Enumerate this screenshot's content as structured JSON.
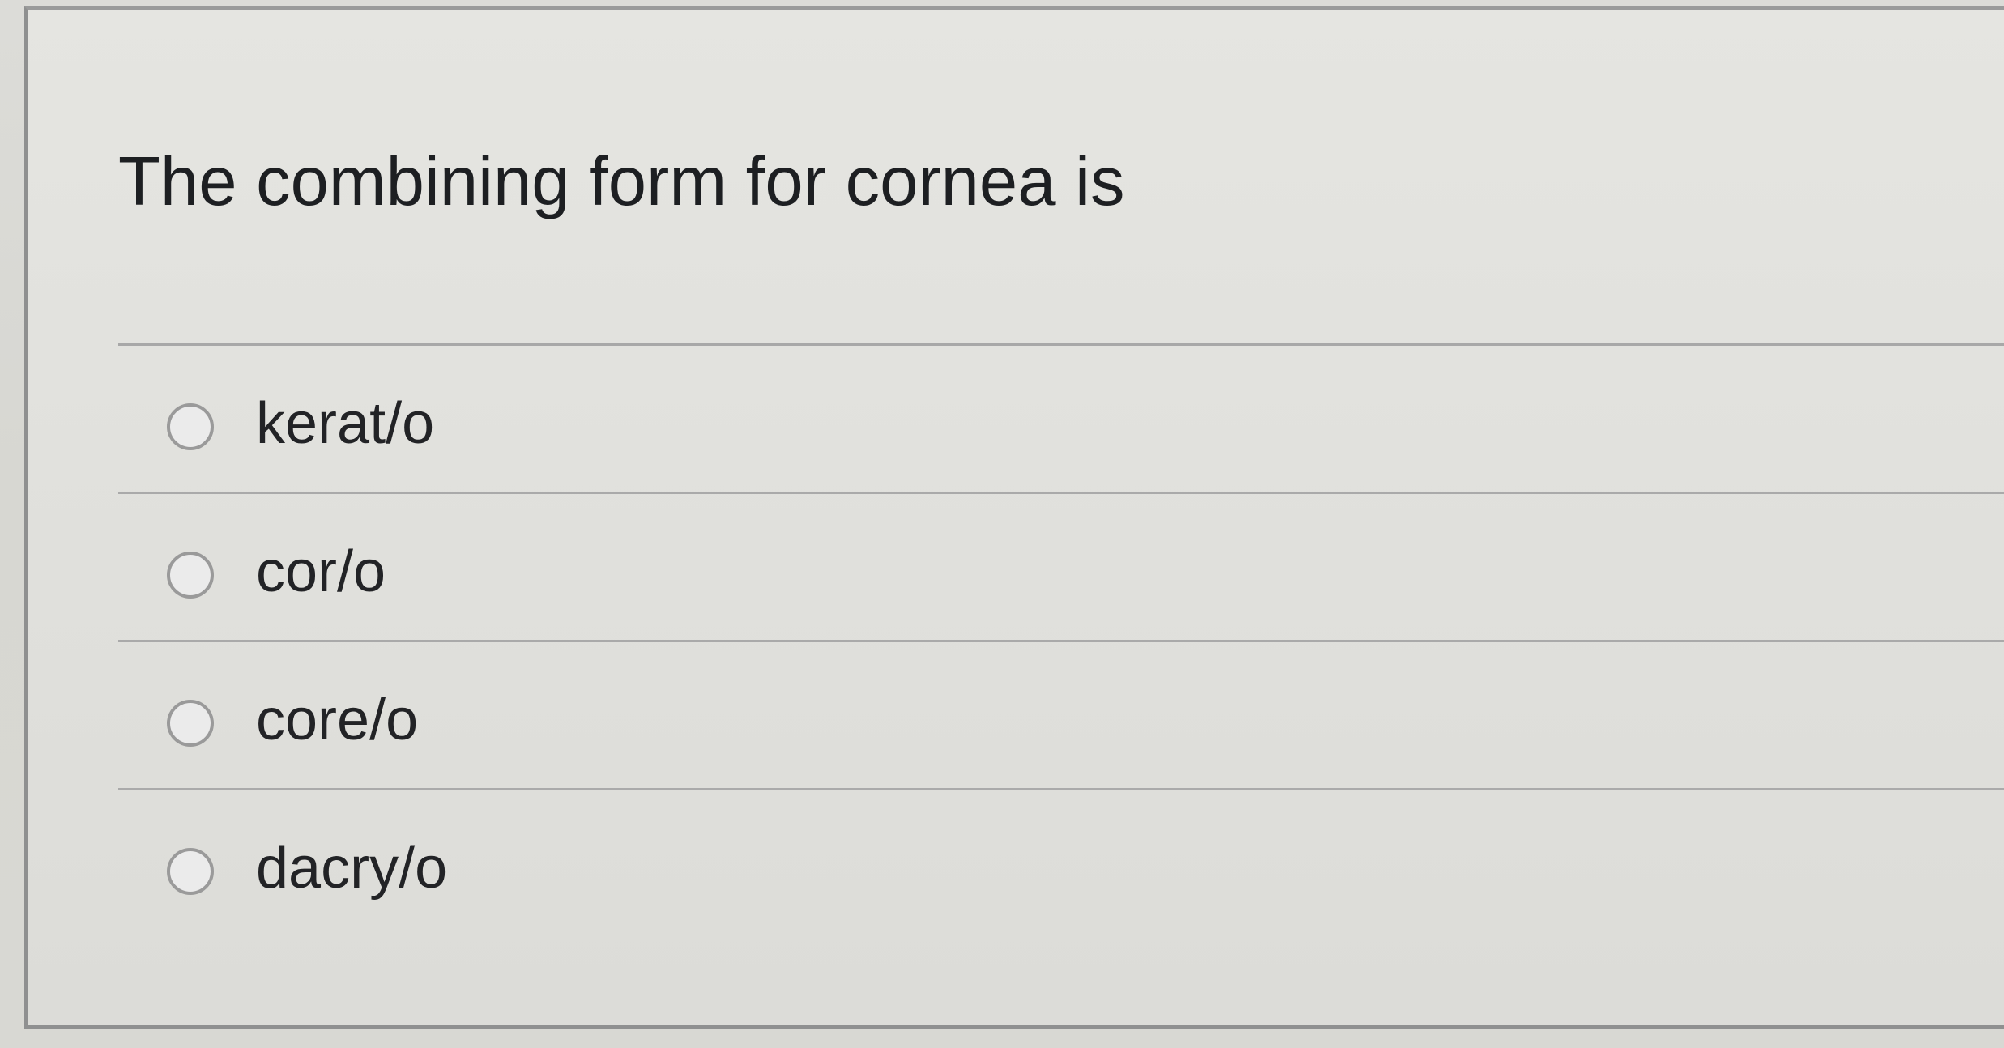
{
  "question": {
    "text": "The combining form for cornea is"
  },
  "options": [
    {
      "label": "kerat/o"
    },
    {
      "label": "cor/o"
    },
    {
      "label": "core/o"
    },
    {
      "label": "dacry/o"
    }
  ],
  "colors": {
    "background": "#d8d8d4",
    "card": "#e3e3df",
    "text": "#1d1f22",
    "divider": "#aaaaaa",
    "radio_border": "#9a9a9a"
  }
}
